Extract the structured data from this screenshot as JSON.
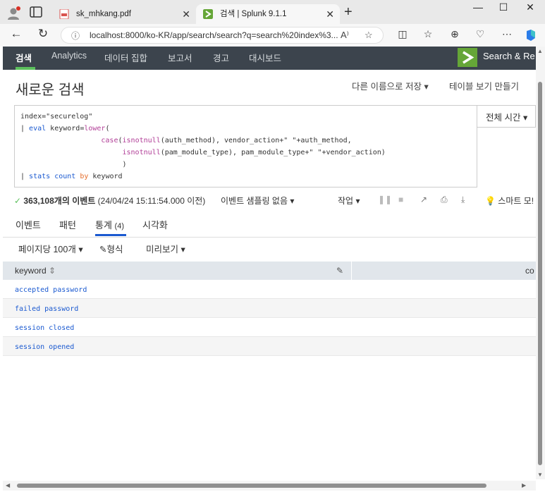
{
  "browser": {
    "tabs": [
      {
        "title": "sk_mhkang.pdf",
        "icon": "pdf-icon"
      },
      {
        "title": "검색 | Splunk 9.1.1",
        "icon": "splunk-icon"
      }
    ],
    "url": "localhost:8000/ko-KR/app/search/search?q=search%20index%3...",
    "colors": {
      "pdf_icon": "#d9534f",
      "splunk_icon": "#65a637"
    }
  },
  "splunk_nav": {
    "items": [
      "검색",
      "Analytics",
      "데이터 집합",
      "보고서",
      "경고",
      "대시보드"
    ],
    "active": "검색",
    "brand": "Search & Re",
    "colors": {
      "bar": "#3c444d",
      "accent": "#5cc05c"
    }
  },
  "header": {
    "title": "새로운 검색",
    "save_as": "다른 이름으로 저장",
    "create_table": "테이블 보기 만들기"
  },
  "search": {
    "lines": [
      "index=\"securelog\"",
      "| eval keyword=lower(",
      "case(isnotnull(auth_method), vendor_action+\" \"+auth_method,",
      "isnotnull(pam_module_type), pam_module_type+\" \"+vendor_action)",
      ")",
      "| stats count by keyword"
    ],
    "time_range": "전체 시간"
  },
  "results_bar": {
    "count": "363,108개의 이벤트",
    "timestamp": "(24/04/24 15:11:54.000 이전)",
    "sampling": "이벤트 샘플링 없음",
    "job": "작업",
    "smart_mode": "스마트 모!"
  },
  "result_tabs": {
    "events": "이벤트",
    "patterns": "패턴",
    "statistics": "통계",
    "statistics_count": "(4)",
    "visualization": "시각화"
  },
  "options": {
    "per_page": "페이지당 100개",
    "format": "형식",
    "preview": "미리보기"
  },
  "table": {
    "columns": [
      "keyword",
      "co"
    ],
    "rows": [
      "accepted password",
      "failed password",
      "session closed",
      "session opened"
    ]
  }
}
